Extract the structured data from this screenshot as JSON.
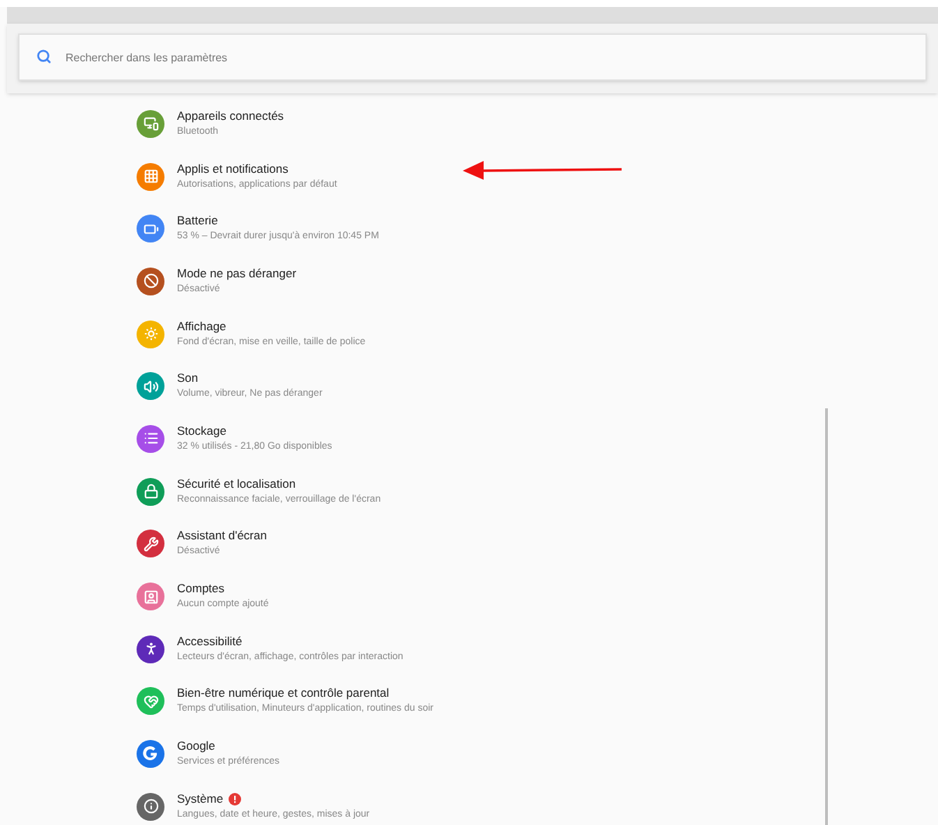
{
  "search": {
    "placeholder": "Rechercher dans les paramètres"
  },
  "items": [
    {
      "title": "Appareils connectés",
      "subtitle": "Bluetooth",
      "color": "#689f38",
      "alert": false
    },
    {
      "title": "Applis et notifications",
      "subtitle": "Autorisations, applications par défaut",
      "color": "#f57c00",
      "alert": false
    },
    {
      "title": "Batterie",
      "subtitle": "53 % – Devrait durer jusqu'à environ 10:45 PM",
      "color": "#4285f4",
      "alert": false
    },
    {
      "title": "Mode ne pas déranger",
      "subtitle": "Désactivé",
      "color": "#b5501f",
      "alert": false
    },
    {
      "title": "Affichage",
      "subtitle": "Fond d'écran, mise en veille, taille de police",
      "color": "#f4b400",
      "alert": false
    },
    {
      "title": "Son",
      "subtitle": "Volume, vibreur, Ne pas déranger",
      "color": "#00a199",
      "alert": false
    },
    {
      "title": "Stockage",
      "subtitle": "32 % utilisés - 21,80 Go disponibles",
      "color": "#a64ee8",
      "alert": false
    },
    {
      "title": "Sécurité et localisation",
      "subtitle": "Reconnaissance faciale, verrouillage de l'écran",
      "color": "#0f9d58",
      "alert": false
    },
    {
      "title": "Assistant d'écran",
      "subtitle": "Désactivé",
      "color": "#d32f3f",
      "alert": false
    },
    {
      "title": "Comptes",
      "subtitle": "Aucun compte ajouté",
      "color": "#e8719a",
      "alert": false
    },
    {
      "title": "Accessibilité",
      "subtitle": "Lecteurs d'écran, affichage, contrôles par interaction",
      "color": "#5e2ab8",
      "alert": false
    },
    {
      "title": "Bien-être numérique et contrôle parental",
      "subtitle": "Temps d'utilisation, Minuteurs d'application, routines du soir",
      "color": "#1fbf5a",
      "alert": false
    },
    {
      "title": "Google",
      "subtitle": "Services et préférences",
      "color": "#1a73e8",
      "alert": false
    },
    {
      "title": "Système",
      "subtitle": "Langues, date et heure, gestes, mises à jour",
      "color": "#666666",
      "alert": true
    }
  ]
}
